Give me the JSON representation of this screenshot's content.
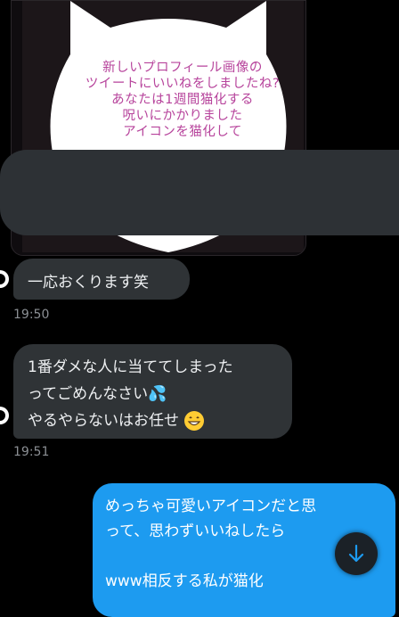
{
  "image_message": {
    "handwritten_lines": [
      "新しいプロフィール画像の",
      "ツイートにいいねをしましたね?",
      "あなたは1週間猫化する",
      "呪いにかかりました",
      "アイコンを猫化して",
      ""
    ]
  },
  "messages": [
    {
      "text": "一応おくります笑",
      "time": "19:50"
    },
    {
      "lines": [
        "1番ダメな人に当ててしまった",
        "ってごめんなさい💦",
        "やるやらないはお任せ"
      ],
      "emoji": "grinning-face-emoji",
      "time": "19:51"
    }
  ],
  "own_message": {
    "lines": [
      "めっちゃ可愛いアイコンだと思",
      "って、思わずいいねしたら",
      "",
      "www相反する私が猫化"
    ]
  },
  "colors": {
    "own_bubble": "#1d9bf0",
    "received_bubble": "#2f3336",
    "handwriting": "#b7449c",
    "redaction": "#2d3135"
  },
  "icons": {
    "scroll_down": "arrow-down-icon"
  }
}
